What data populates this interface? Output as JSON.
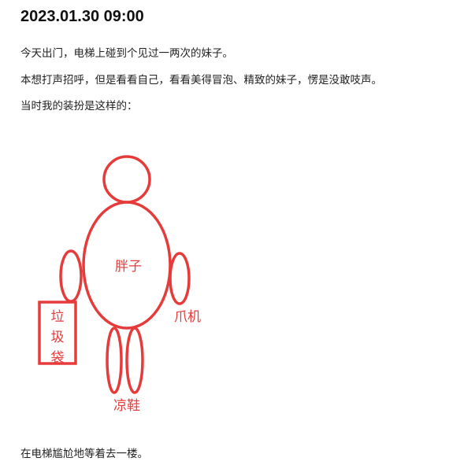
{
  "post": {
    "title": "2023.01.30 09:00",
    "paragraphs": [
      "今天出门，电梯上碰到个见过一两次的妹子。",
      "本想打声招呼，但是看看自己，看看美得冒泡、精致的妹子，愣是没敢吱声。",
      "当时我的装扮是这样的：",
      "在电梯尴尬地等着去一楼。"
    ]
  },
  "figure": {
    "stroke_color": "#e63b3b",
    "labels": {
      "body": "胖子",
      "phone": "爪机",
      "bag": [
        "垃",
        "圾",
        "袋"
      ],
      "shoes": "凉鞋"
    }
  }
}
